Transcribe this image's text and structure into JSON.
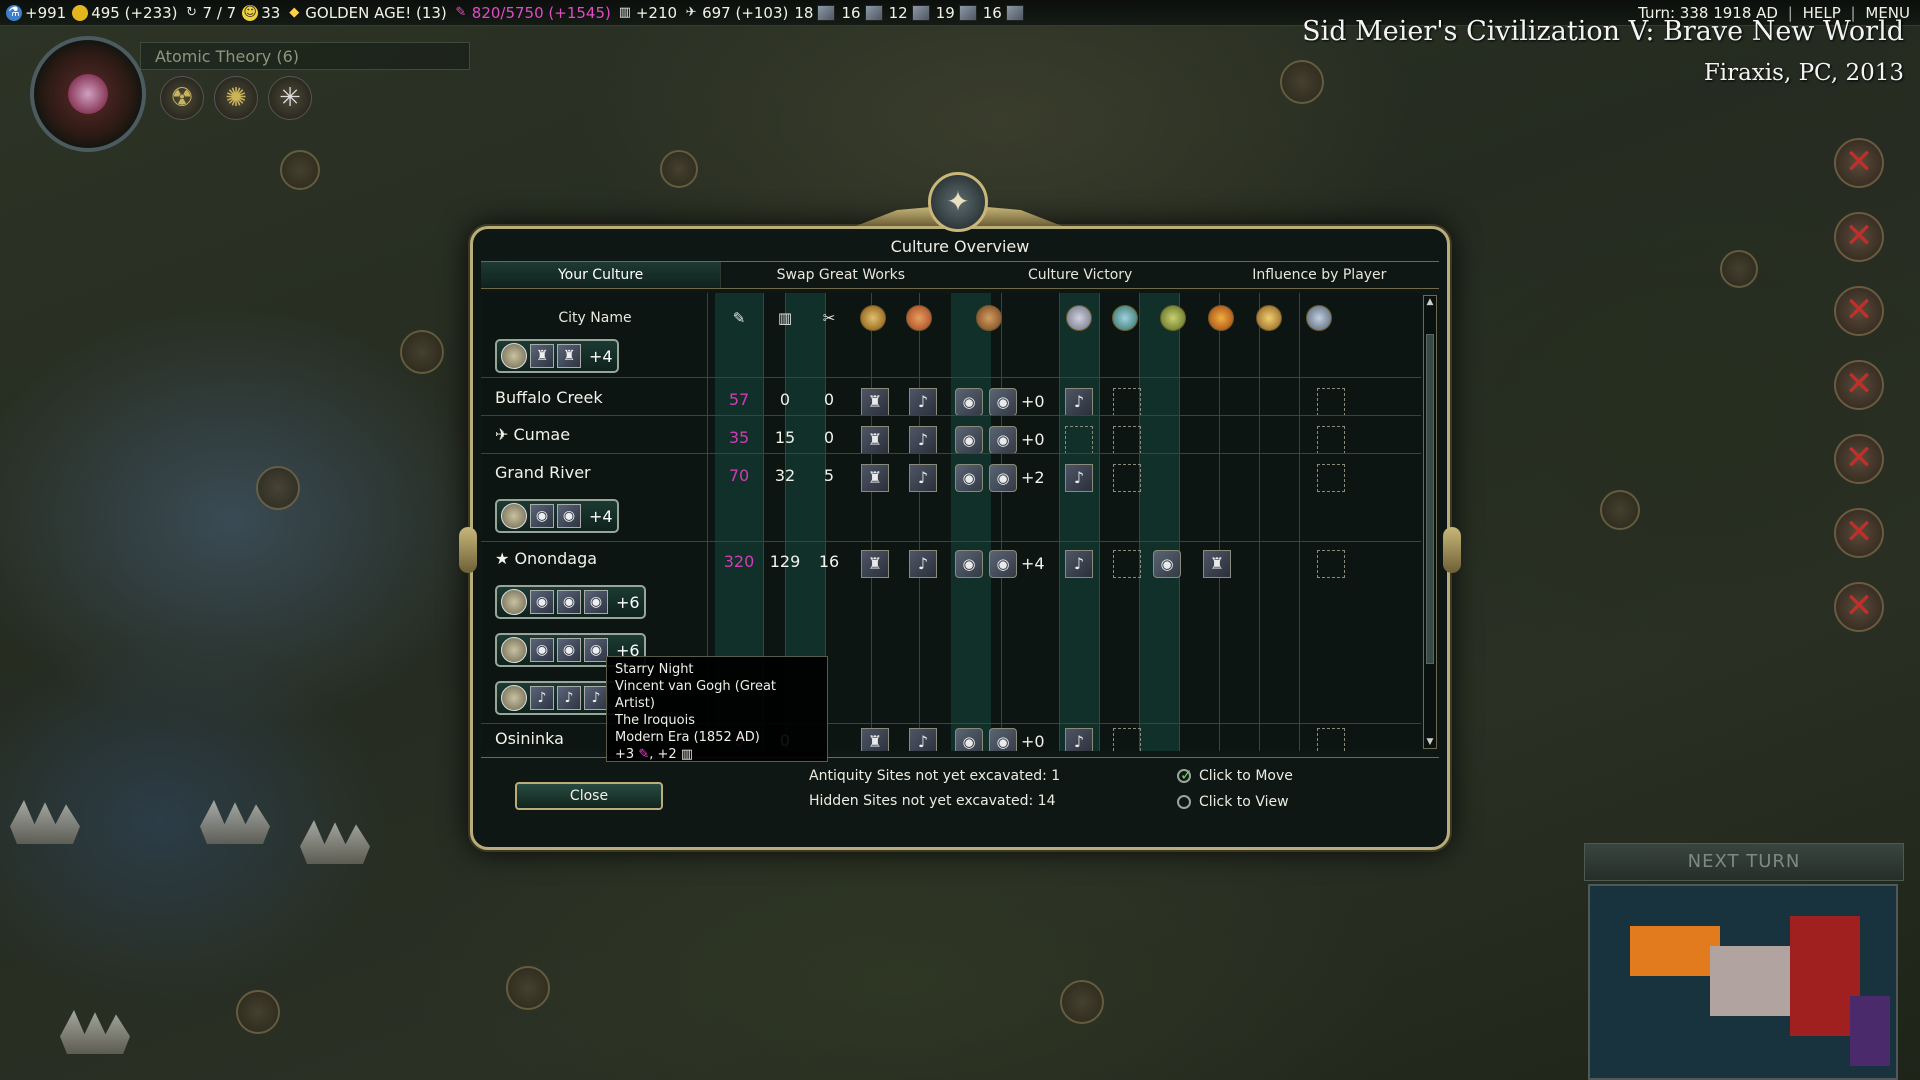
{
  "topbar": {
    "science": "+991",
    "gold": "495 (+233)",
    "turn_counter": "7 / 7",
    "happiness": "33",
    "golden_age": "GOLDEN AGE! (13)",
    "culture": "820/5750 (+1545)",
    "tourism": "+210",
    "faith": "697 (+103)",
    "resources": [
      {
        "count": "18",
        "icon": "aluminum-icon"
      },
      {
        "count": "16",
        "icon": "horses-icon"
      },
      {
        "count": "12",
        "icon": "iron-icon"
      },
      {
        "count": "19",
        "icon": "coal-icon"
      },
      {
        "count": "16",
        "icon": "oil-icon"
      }
    ],
    "turn_info": "Turn: 338  1918 AD",
    "help": "HELP",
    "menu": "MENU"
  },
  "watermark": {
    "title": "Sid Meier's Civilization V: Brave New World",
    "subtitle": "Firaxis, PC, 2013"
  },
  "research": {
    "tech": "Atomic Theory (6)"
  },
  "right_panel": {
    "next_turn": "NEXT TURN"
  },
  "dialog": {
    "title": "Culture Overview",
    "tabs": [
      "Your Culture",
      "Swap Great Works",
      "Culture Victory",
      "Influence by Player"
    ],
    "city_name_header": "City Name",
    "rows": {
      "buffalo": {
        "name": "Buffalo Creek",
        "culture": "57",
        "tourism": "0",
        "works": "0",
        "bonus": "+0"
      },
      "cumae": {
        "name": "Cumae",
        "culture": "35",
        "tourism": "15",
        "works": "0",
        "bonus": "+0"
      },
      "grand": {
        "name": "Grand River",
        "culture": "70",
        "tourism": "32",
        "works": "5",
        "bonus": "+2",
        "theme_bonus": "+4"
      },
      "onondaga": {
        "name": "Onondaga",
        "culture": "320",
        "tourism": "129",
        "works": "16",
        "bonus": "+4",
        "theme1": "+6",
        "theme2": "+6"
      },
      "osininka": {
        "name": "Osininka",
        "culture": "0",
        "tourism": "0",
        "bonus": "+0"
      },
      "top_theme_bonus": "+4"
    },
    "footer": {
      "close": "Close",
      "antiquity": "Antiquity Sites not yet excavated: 1",
      "hidden": "Hidden Sites not yet excavated: 14",
      "move": "Click to Move",
      "view": "Click to View"
    }
  },
  "tooltip": {
    "line1": "Starry Night",
    "line2": "Vincent van Gogh (Great Artist)",
    "line3": "The Iroquois",
    "line4": "Modern Era (1852 AD)",
    "line5_culture": "+3",
    "line5_tourism": ", +2"
  }
}
